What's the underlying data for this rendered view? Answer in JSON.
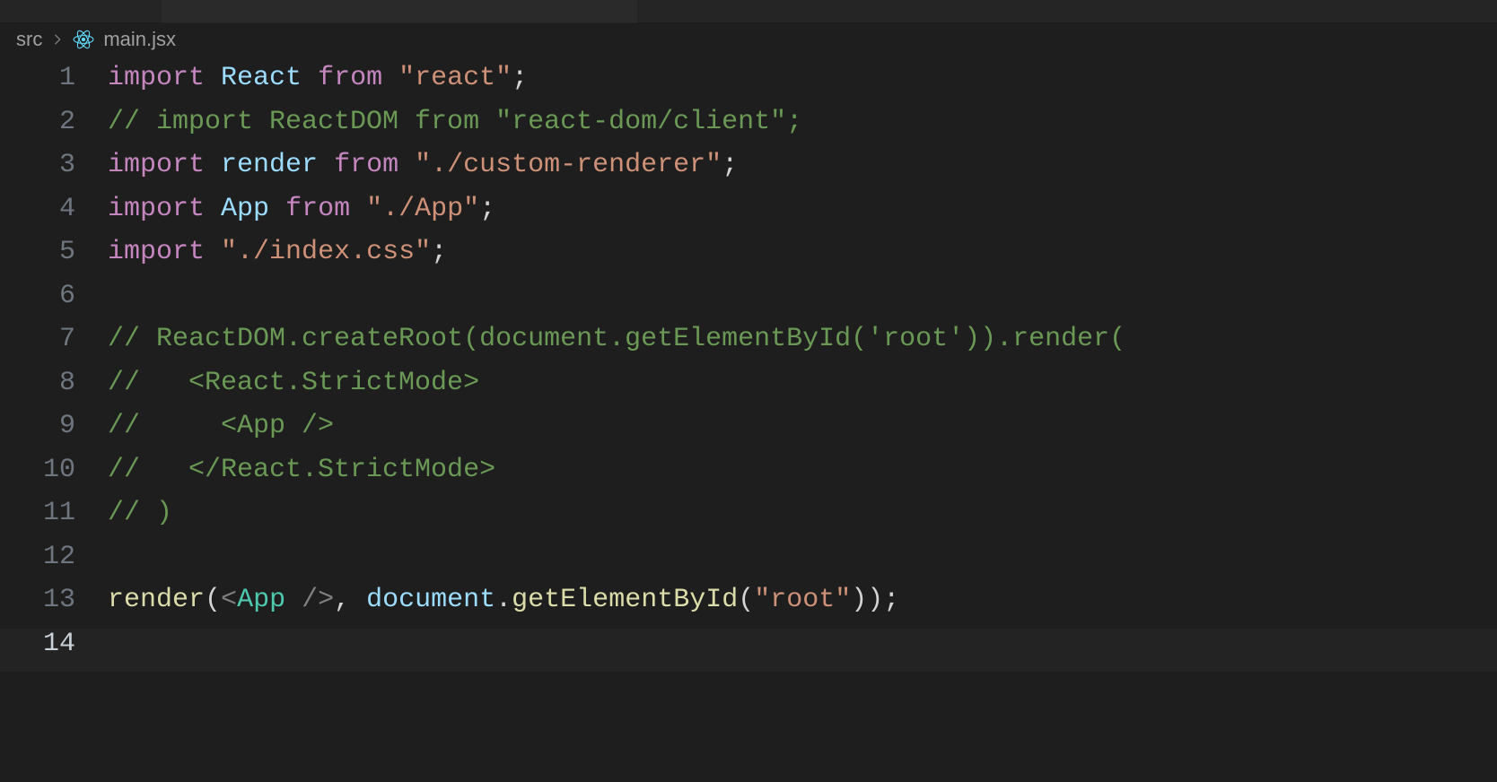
{
  "breadcrumbs": {
    "segments": [
      "src",
      "main.jsx"
    ]
  },
  "code": {
    "lines": [
      {
        "n": 1,
        "tokens": [
          [
            "kw",
            "import"
          ],
          [
            "punct",
            " "
          ],
          [
            "var",
            "React"
          ],
          [
            "punct",
            " "
          ],
          [
            "kw",
            "from"
          ],
          [
            "punct",
            " "
          ],
          [
            "str",
            "\"react\""
          ],
          [
            "punct",
            ";"
          ]
        ]
      },
      {
        "n": 2,
        "tokens": [
          [
            "comment",
            "// import ReactDOM from \"react-dom/client\";"
          ]
        ]
      },
      {
        "n": 3,
        "tokens": [
          [
            "kw",
            "import"
          ],
          [
            "punct",
            " "
          ],
          [
            "var",
            "render"
          ],
          [
            "punct",
            " "
          ],
          [
            "kw",
            "from"
          ],
          [
            "punct",
            " "
          ],
          [
            "str",
            "\"./custom-renderer\""
          ],
          [
            "punct",
            ";"
          ]
        ]
      },
      {
        "n": 4,
        "tokens": [
          [
            "kw",
            "import"
          ],
          [
            "punct",
            " "
          ],
          [
            "var",
            "App"
          ],
          [
            "punct",
            " "
          ],
          [
            "kw",
            "from"
          ],
          [
            "punct",
            " "
          ],
          [
            "str",
            "\"./App\""
          ],
          [
            "punct",
            ";"
          ]
        ]
      },
      {
        "n": 5,
        "tokens": [
          [
            "kw",
            "import"
          ],
          [
            "punct",
            " "
          ],
          [
            "str",
            "\"./index.css\""
          ],
          [
            "punct",
            ";"
          ]
        ]
      },
      {
        "n": 6,
        "tokens": []
      },
      {
        "n": 7,
        "tokens": [
          [
            "comment",
            "// ReactDOM.createRoot(document.getElementById('root')).render("
          ]
        ]
      },
      {
        "n": 8,
        "tokens": [
          [
            "comment",
            "//   <React.StrictMode>"
          ]
        ]
      },
      {
        "n": 9,
        "tokens": [
          [
            "comment",
            "//     <App />"
          ]
        ]
      },
      {
        "n": 10,
        "tokens": [
          [
            "comment",
            "//   </React.StrictMode>"
          ]
        ]
      },
      {
        "n": 11,
        "tokens": [
          [
            "comment",
            "// )"
          ]
        ]
      },
      {
        "n": 12,
        "tokens": []
      },
      {
        "n": 13,
        "tokens": [
          [
            "func",
            "render"
          ],
          [
            "punct",
            "("
          ],
          [
            "jsxbr",
            "<"
          ],
          [
            "jsxtag",
            "App"
          ],
          [
            "punct",
            " "
          ],
          [
            "jsxbr",
            "/>"
          ],
          [
            "punct",
            ", "
          ],
          [
            "var",
            "document"
          ],
          [
            "punct",
            "."
          ],
          [
            "func",
            "getElementById"
          ],
          [
            "punct",
            "("
          ],
          [
            "str",
            "\"root\""
          ],
          [
            "punct",
            "));"
          ]
        ]
      },
      {
        "n": 14,
        "tokens": [],
        "current": true
      }
    ]
  }
}
